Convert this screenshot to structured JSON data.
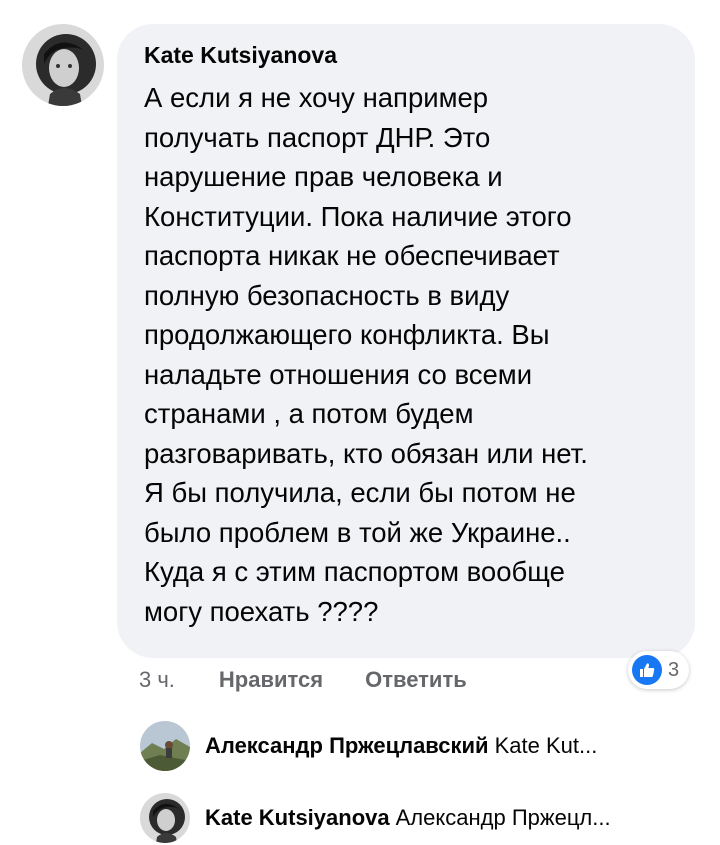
{
  "comment": {
    "author": "Kate Kutsiyanova",
    "text": "А если я не хочу например\nполучать паспорт ДНР. Это\nнарушение прав человека и\nКонституции. Пока наличие этого\nпаспорта никак не обеспечивает\nполную безопасность в виду\nпродолжающего конфликта. Вы\nналадьте отношения со всеми\nстранами , а потом будем\nразговаривать, кто обязан или нет.\nЯ бы получила, если бы потом не\nбыло проблем в той же Украине..\nКуда я с этим паспортом вообще\nмогу поехать ????",
    "time": "3 ч.",
    "like_label": "Нравится",
    "reply_label": "Ответить",
    "reaction": {
      "icon": "like-thumbs-up-icon",
      "count": "3",
      "color": "#1877f2"
    }
  },
  "replies": [
    {
      "author": "Александр Пржецлавский",
      "preview": "Kate Kut..."
    },
    {
      "author": "Kate Kutsiyanova",
      "preview": "Александр Пржецл..."
    }
  ],
  "colors": {
    "bubble_bg": "#f0f2f5",
    "secondary_text": "#65676b",
    "primary_text": "#050505",
    "like_blue": "#1877f2"
  }
}
